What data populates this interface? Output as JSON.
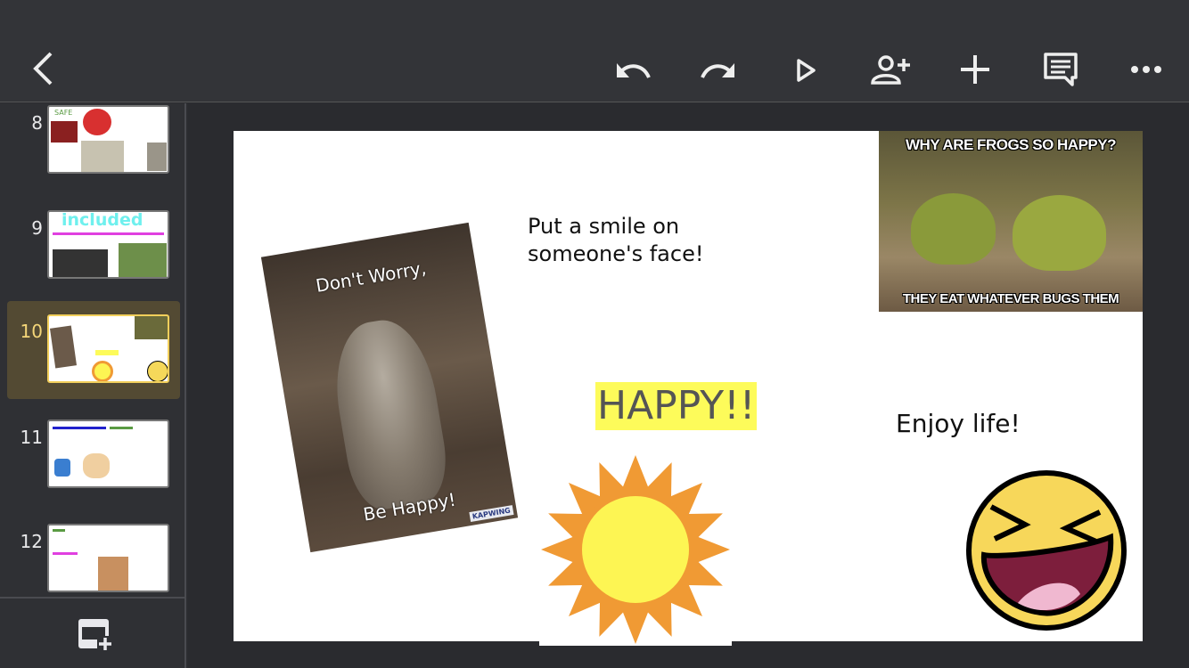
{
  "toolbar": {
    "icons": [
      "back-icon",
      "undo-icon",
      "redo-icon",
      "play-icon",
      "add-person-icon",
      "plus-icon",
      "comment-icon",
      "more-icon"
    ]
  },
  "sidebar": {
    "slides": [
      {
        "number": "8",
        "texts": [
          "SAFE"
        ]
      },
      {
        "number": "9",
        "texts": [
          "included"
        ]
      },
      {
        "number": "10",
        "selected": true
      },
      {
        "number": "11"
      },
      {
        "number": "12"
      }
    ]
  },
  "slide": {
    "smile_text": "Put a smile on someone's face!",
    "happy_text": "HAPPY!!",
    "enjoy_text": "Enjoy life!",
    "cat_image": {
      "top_text": "Don't Worry,",
      "bottom_text": "Be Happy!",
      "watermark": "KAPWING"
    },
    "frog_image": {
      "top_text": "WHY ARE FROGS SO HAPPY?",
      "bottom_text": "THEY EAT WHATEVER BUGS THEM"
    }
  },
  "colors": {
    "highlight": "#fdfb5a",
    "selected": "#f2cf5b",
    "sun_rays": "#f09a34",
    "sun_core": "#fdf553",
    "included": "#6ff0ee"
  }
}
